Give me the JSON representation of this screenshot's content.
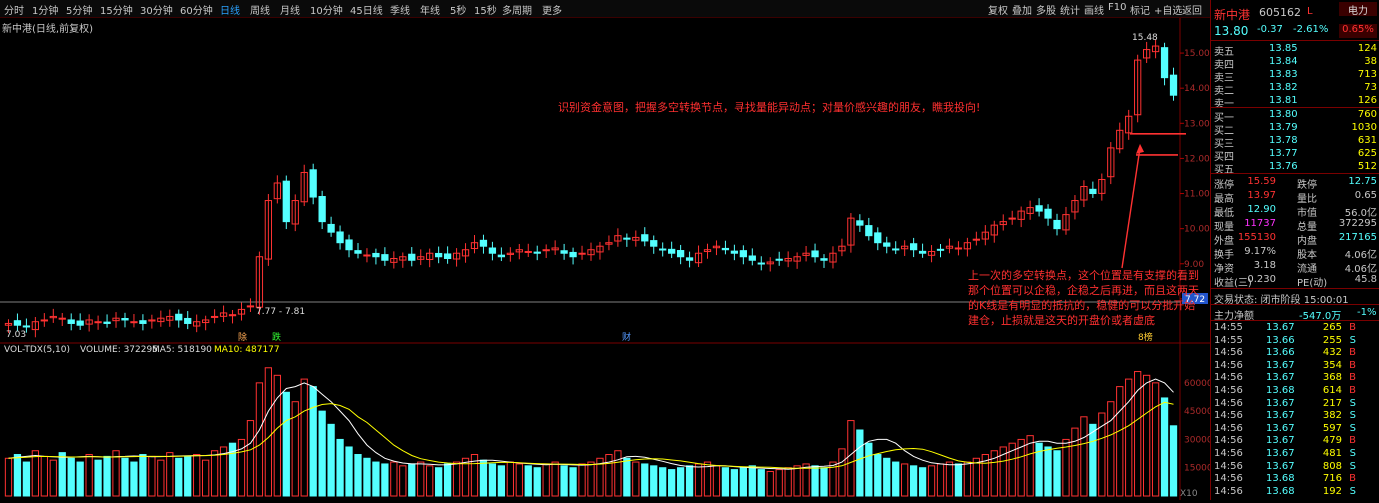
{
  "toolbar": {
    "periods": [
      "分时",
      "1分钟",
      "5分钟",
      "15分钟",
      "30分钟",
      "60分钟",
      "日线",
      "周线",
      "月线",
      "10分钟",
      "45日线",
      "季线",
      "年线",
      "5秒",
      "15秒",
      "多周期",
      "更多"
    ],
    "active_period": "日线",
    "right_buttons": [
      "复权",
      "叠加",
      "多股",
      "统计",
      "画线",
      "F10",
      "标记",
      "+自选",
      "返回"
    ]
  },
  "chart": {
    "title": "新中港(日线,前复权)",
    "y_ticks": [
      "15.00",
      "14.00",
      "13.00",
      "12.00",
      "11.00",
      "10.00",
      "9.00",
      "8.00"
    ],
    "high_label": "15.48",
    "low_label": "7.03",
    "range_label": "7.77 - 7.81",
    "price_flag": "7.72",
    "markers": [
      "除",
      "跌",
      "财",
      "8榜"
    ],
    "vol_title": "VOL-TDX(5,10)",
    "vol_value": "VOLUME: 372295",
    "ma5_value": "MA5: 518190",
    "ma10_value": "MA10: 487177",
    "vol_ticks": [
      "60000",
      "45000",
      "30000",
      "15000"
    ],
    "vol_unit": "X10",
    "annotation_top": "识别资金意图，把握多空转换节点，寻找量能异动点；对量价感兴趣的朋友，瞧我投向!",
    "annotation_bottom": "上一次的多空转换点，这个位置是有支撑的看到那个位置可以企稳，企稳之后再进，而且这两天的K线是有明显的抵抗的，稳健的可以分批开始建仓，止损就是这天的开盘价或者虚底",
    "colors": {
      "up": "#ff3232",
      "down": "#54ffff",
      "ma5": "#ffffff",
      "ma10": "#ffff00",
      "accent": "#2aa2ff"
    }
  },
  "chart_data": {
    "type": "candlestick",
    "ylim": [
      7.0,
      15.6
    ],
    "closes": [
      7.3,
      7.25,
      7.2,
      7.35,
      7.4,
      7.5,
      7.45,
      7.3,
      7.25,
      7.4,
      7.35,
      7.3,
      7.45,
      7.4,
      7.35,
      7.3,
      7.4,
      7.45,
      7.5,
      7.4,
      7.3,
      7.35,
      7.4,
      7.5,
      7.6,
      7.55,
      7.7,
      7.8,
      9.2,
      10.8,
      11.3,
      10.2,
      10.8,
      11.6,
      10.9,
      10.2,
      9.9,
      9.6,
      9.4,
      9.3,
      9.25,
      9.2,
      9.1,
      9.15,
      9.2,
      9.1,
      9.2,
      9.3,
      9.2,
      9.15,
      9.3,
      9.4,
      9.6,
      9.5,
      9.3,
      9.2,
      9.3,
      9.4,
      9.35,
      9.3,
      9.4,
      9.45,
      9.3,
      9.2,
      9.3,
      9.4,
      9.5,
      9.6,
      9.8,
      9.7,
      9.75,
      9.65,
      9.5,
      9.4,
      9.3,
      9.2,
      9.1,
      9.3,
      9.4,
      9.5,
      9.4,
      9.3,
      9.2,
      9.1,
      9.0,
      9.05,
      9.1,
      9.15,
      9.2,
      9.3,
      9.2,
      9.1,
      9.3,
      9.5,
      10.3,
      10.1,
      9.8,
      9.6,
      9.5,
      9.4,
      9.5,
      9.4,
      9.3,
      9.35,
      9.4,
      9.5,
      9.45,
      9.6,
      9.7,
      9.9,
      10.1,
      10.2,
      10.3,
      10.5,
      10.6,
      10.5,
      10.3,
      10.0,
      10.4,
      10.8,
      11.2,
      11.0,
      11.4,
      12.3,
      12.8,
      13.2,
      14.8,
      15.1,
      15.2,
      14.3,
      13.8
    ],
    "volumes": [
      20000,
      22000,
      18000,
      24000,
      21000,
      19000,
      23000,
      20000,
      18000,
      22000,
      19000,
      21000,
      24000,
      20000,
      18000,
      22000,
      21000,
      19000,
      23000,
      20000,
      21000,
      22000,
      19000,
      24000,
      26000,
      28000,
      30000,
      40000,
      60000,
      68000,
      64000,
      55000,
      50000,
      62000,
      58000,
      45000,
      38000,
      30000,
      26000,
      22000,
      20000,
      18000,
      17000,
      18000,
      16000,
      17000,
      18000,
      16000,
      15000,
      17000,
      18000,
      20000,
      22000,
      19000,
      17000,
      16000,
      18000,
      17000,
      16000,
      15000,
      17000,
      18000,
      16000,
      15000,
      17000,
      18000,
      20000,
      22000,
      24000,
      20000,
      18000,
      17000,
      16000,
      15000,
      14000,
      15000,
      16000,
      17000,
      18000,
      16000,
      15000,
      14000,
      15000,
      16000,
      14000,
      13000,
      14000,
      15000,
      16000,
      17000,
      16000,
      15000,
      18000,
      25000,
      40000,
      35000,
      28000,
      22000,
      20000,
      18000,
      17000,
      16000,
      15000,
      16000,
      17000,
      18000,
      17000,
      18000,
      20000,
      22000,
      24000,
      26000,
      28000,
      30000,
      32000,
      28000,
      26000,
      24000,
      30000,
      36000,
      42000,
      38000,
      44000,
      50000,
      58000,
      62000,
      66000,
      64000,
      60000,
      52000,
      37229
    ],
    "ma5": [
      20000,
      20500,
      21000,
      21500,
      21000,
      20800,
      20600,
      20500,
      20800,
      21000,
      20800,
      20600,
      20900,
      21000,
      21200,
      21100,
      20800,
      20900,
      21000,
      21200,
      21300,
      21400,
      21500,
      21800,
      22500,
      23500,
      25000,
      28000,
      35000,
      45000,
      52000,
      57000,
      58000,
      60000,
      58000,
      54000,
      50000,
      45000,
      40000,
      33000,
      27000,
      23000,
      20000,
      18500,
      17500,
      17000,
      17000,
      16800,
      16500,
      16600,
      17000,
      17800,
      18500,
      19000,
      19000,
      18500,
      18000,
      17500,
      17200,
      16800,
      16600,
      16800,
      16700,
      16500,
      16400,
      16600,
      17200,
      18000,
      19200,
      20800,
      21000,
      20500,
      19500,
      18400,
      17200,
      16200,
      15600,
      15400,
      15600,
      16000,
      16000,
      15600,
      15200,
      15000,
      14800,
      14600,
      14400,
      14200,
      14600,
      15200,
      15600,
      15800,
      16200,
      18000,
      22000,
      26000,
      29000,
      30000,
      30000,
      28000,
      24000,
      21000,
      19000,
      17600,
      17000,
      16600,
      16600,
      17000,
      17600,
      18600,
      20000,
      22000,
      24000,
      26000,
      28000,
      29000,
      29000,
      28000,
      28000,
      29000,
      31000,
      34000,
      37000,
      40000,
      45000,
      50000,
      56000,
      60000,
      62000,
      60000,
      55000
    ],
    "ma10": [
      20000,
      20300,
      20600,
      20900,
      21000,
      20900,
      20800,
      20700,
      20700,
      20800,
      20800,
      20700,
      20700,
      20800,
      20900,
      21000,
      21000,
      21000,
      21000,
      21100,
      21200,
      21300,
      21400,
      21600,
      22000,
      22600,
      23400,
      24500,
      27000,
      31000,
      36000,
      40000,
      42000,
      45000,
      47000,
      48500,
      49000,
      48000,
      46000,
      42000,
      39000,
      35000,
      31000,
      27000,
      24000,
      21500,
      19800,
      18800,
      18000,
      17500,
      17200,
      17100,
      17200,
      17400,
      17600,
      17800,
      17800,
      17600,
      17400,
      17200,
      17000,
      16900,
      16900,
      16800,
      16700,
      16700,
      16900,
      17300,
      17900,
      18600,
      19200,
      19600,
      19800,
      19600,
      19100,
      18600,
      17900,
      17200,
      16600,
      16200,
      15900,
      15700,
      15500,
      15400,
      15300,
      15200,
      15000,
      14800,
      14700,
      14700,
      14800,
      14900,
      15200,
      16000,
      17800,
      19600,
      21300,
      22500,
      23600,
      24500,
      25000,
      25200,
      24800,
      23500,
      21800,
      20100,
      18600,
      17900,
      17500,
      17400,
      17800,
      18500,
      19500,
      20800,
      22300,
      23600,
      24500,
      25300,
      26000,
      26800,
      27800,
      29000,
      30600,
      32400,
      34700,
      37300,
      40600,
      44000,
      47300,
      49700,
      48700
    ]
  },
  "side": {
    "stock_name": "新中港",
    "stock_code": "605162",
    "flag": "L",
    "sector_name": "电力",
    "sector_change": "0.65%",
    "last": "13.80",
    "change": "-0.37",
    "change_pct": "-2.61%",
    "asks": [
      {
        "label": "卖五",
        "price": "13.85",
        "vol": "124"
      },
      {
        "label": "卖四",
        "price": "13.84",
        "vol": "38"
      },
      {
        "label": "卖三",
        "price": "13.83",
        "vol": "713"
      },
      {
        "label": "卖二",
        "price": "13.82",
        "vol": "73"
      },
      {
        "label": "卖一",
        "price": "13.81",
        "vol": "126"
      }
    ],
    "bids": [
      {
        "label": "买一",
        "price": "13.80",
        "vol": "760"
      },
      {
        "label": "买二",
        "price": "13.79",
        "vol": "1030"
      },
      {
        "label": "买三",
        "price": "13.78",
        "vol": "631"
      },
      {
        "label": "买四",
        "price": "13.77",
        "vol": "625"
      },
      {
        "label": "买五",
        "price": "13.76",
        "vol": "512"
      }
    ],
    "stats": [
      {
        "l1": "涨停",
        "v1": "15.59",
        "l2": "跌停",
        "v2": "12.75"
      },
      {
        "l1": "最高",
        "v1": "13.97",
        "l2": "量比",
        "v2": "0.65"
      },
      {
        "l1": "最低",
        "v1": "12.90",
        "l2": "市值",
        "v2": "56.0亿"
      },
      {
        "l1": "现量",
        "v1": "11737",
        "l2": "总量",
        "v2": "372295"
      },
      {
        "l1": "外盘",
        "v1": "155130",
        "l2": "内盘",
        "v2": "217165"
      },
      {
        "l1": "换手",
        "v1": "9.17%",
        "l2": "股本",
        "v2": "4.06亿"
      },
      {
        "l1": "净资",
        "v1": "3.18",
        "l2": "流通",
        "v2": "4.06亿"
      },
      {
        "l1": "收益(三)",
        "v1": "0.230",
        "l2": "PE(动)",
        "v2": "45.8"
      }
    ],
    "status": "交易状态: 闭市阶段 15:00:01",
    "flow_label": "主力净额",
    "flow_value": "-547.0万",
    "flow_pct": "-1%",
    "ticks": [
      {
        "time": "14:55",
        "price": "13.67",
        "vol": "265",
        "side": "B"
      },
      {
        "time": "14:55",
        "price": "13.66",
        "vol": "255",
        "side": "S"
      },
      {
        "time": "14:56",
        "price": "13.66",
        "vol": "432",
        "side": "B"
      },
      {
        "time": "14:56",
        "price": "13.67",
        "vol": "354",
        "side": "B"
      },
      {
        "time": "14:56",
        "price": "13.67",
        "vol": "368",
        "side": "B"
      },
      {
        "time": "14:56",
        "price": "13.68",
        "vol": "614",
        "side": "B"
      },
      {
        "time": "14:56",
        "price": "13.67",
        "vol": "217",
        "side": "S"
      },
      {
        "time": "14:56",
        "price": "13.67",
        "vol": "382",
        "side": "S"
      },
      {
        "time": "14:56",
        "price": "13.67",
        "vol": "597",
        "side": "S"
      },
      {
        "time": "14:56",
        "price": "13.67",
        "vol": "479",
        "side": "B"
      },
      {
        "time": "14:56",
        "price": "13.67",
        "vol": "481",
        "side": "S"
      },
      {
        "time": "14:56",
        "price": "13.67",
        "vol": "808",
        "side": "S"
      },
      {
        "time": "14:56",
        "price": "13.68",
        "vol": "716",
        "side": "B"
      },
      {
        "time": "14:56",
        "price": "13.68",
        "vol": "192",
        "side": "S"
      }
    ]
  }
}
